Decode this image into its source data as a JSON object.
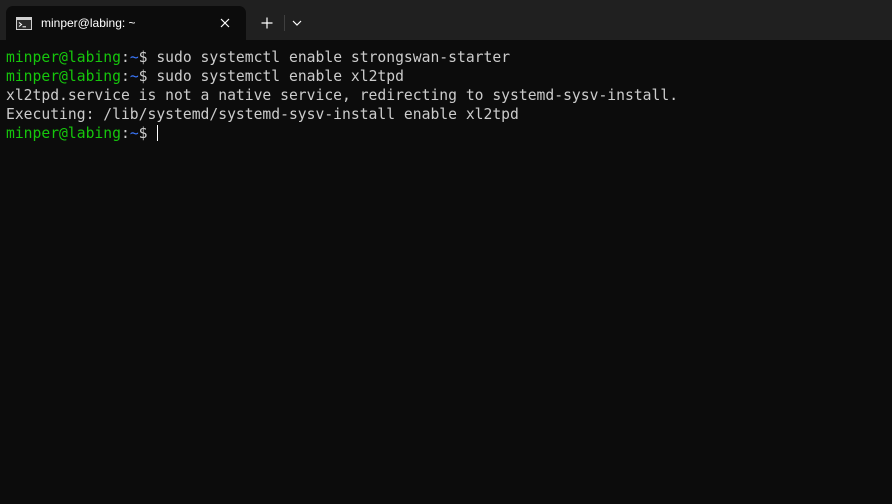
{
  "tab": {
    "title": "minper@labing: ~",
    "icon": "terminal-icon"
  },
  "toolbar": {
    "new_tab_icon": "plus-icon",
    "dropdown_icon": "chevron-down-icon",
    "close_icon": "close-icon"
  },
  "colors": {
    "background": "#0c0c0c",
    "titlebar": "#202020",
    "user_host": "#16c60c",
    "path": "#3b78ff",
    "text": "#cccccc"
  },
  "terminal": {
    "prompt": {
      "user_host": "minper@labing",
      "colon": ":",
      "path": "~",
      "symbol": "$"
    },
    "lines": [
      {
        "type": "command",
        "text": " sudo systemctl enable strongswan-starter"
      },
      {
        "type": "command",
        "text": " sudo systemctl enable xl2tpd"
      },
      {
        "type": "output",
        "text": "xl2tpd.service is not a native service, redirecting to systemd-sysv-install."
      },
      {
        "type": "output",
        "text": "Executing: /lib/systemd/systemd-sysv-install enable xl2tpd"
      },
      {
        "type": "command",
        "text": " "
      }
    ]
  }
}
